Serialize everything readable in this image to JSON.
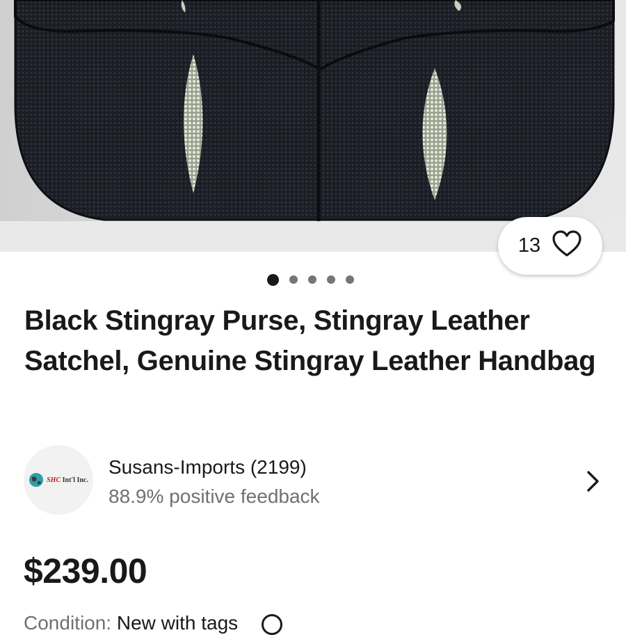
{
  "listing": {
    "image_gallery": {
      "image_subject": "black-stingray-purse-photo",
      "current_index": 1,
      "total_images": 5
    },
    "watchers": {
      "count": "13",
      "icon": "heart-icon"
    },
    "title": "Black Stingray Purse, Stingray Leather Satchel, Genuine Stingray Leather Handbag",
    "seller": {
      "name_with_score": "Susans-Imports (2199)",
      "feedback": "88.9% positive feedback",
      "logo_text_primary": "SHC",
      "logo_text_secondary": "Int'l Inc.",
      "chevron_icon": "chevron-right-icon"
    },
    "price": "$239.00",
    "condition": {
      "label": "Condition:",
      "value": "New with tags"
    }
  },
  "colors": {
    "text_primary": "#191919",
    "text_secondary": "#707070",
    "dot_inactive": "#767676"
  }
}
